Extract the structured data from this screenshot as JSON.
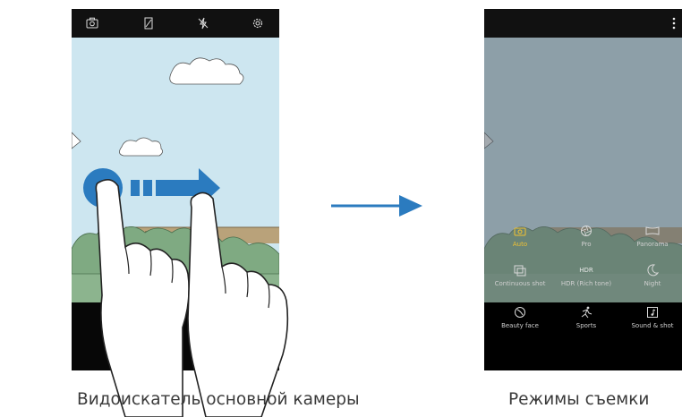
{
  "left_screen": {
    "toolbar_icons": [
      "selfie-switch-icon",
      "hdr-icon",
      "flash-off-icon",
      "settings-icon"
    ]
  },
  "right_screen": {
    "toolbar_icons": [
      "more-options-icon"
    ],
    "modes": [
      {
        "label": "Auto",
        "icon": "camera-icon",
        "active": true
      },
      {
        "label": "Pro",
        "icon": "aperture-icon",
        "active": false
      },
      {
        "label": "Panorama",
        "icon": "panorama-icon",
        "active": false
      },
      {
        "label": "Continuous shot",
        "icon": "burst-icon",
        "active": false
      },
      {
        "label": "HDR (Rich tone)",
        "icon_text": "HDR",
        "active": false
      },
      {
        "label": "Night",
        "icon": "moon-icon",
        "active": false
      },
      {
        "label": "Beauty face",
        "icon": "beauty-face-icon",
        "active": false
      },
      {
        "label": "Sports",
        "icon": "sports-icon",
        "active": false
      },
      {
        "label": "Sound & shot",
        "icon": "music-note-icon",
        "active": false
      }
    ]
  },
  "captions": {
    "left": "Видоискатель основной камеры",
    "right": "Режимы съемки"
  },
  "colors": {
    "accent_blue": "#2b7bbf",
    "active_mode": "#f1c232",
    "sky": "#cde6f0"
  }
}
